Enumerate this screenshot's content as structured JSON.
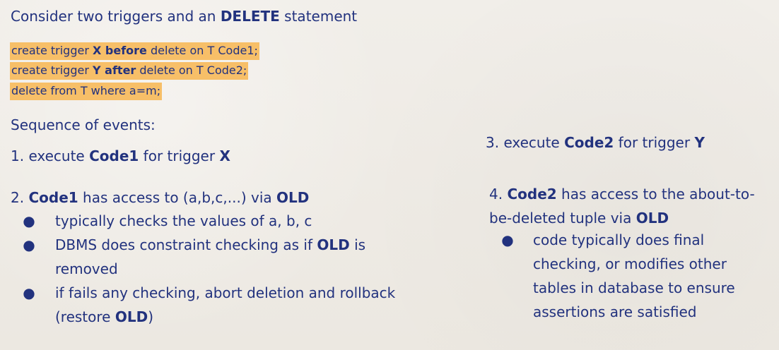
{
  "title": {
    "part1": "Consider two triggers and an ",
    "bold": "DELETE",
    "part2": " statement"
  },
  "code": {
    "line1": {
      "prefix": "create trigger ",
      "bold": "X before",
      "suffix": " delete on T Code1;"
    },
    "line2": {
      "prefix": "create trigger ",
      "bold": "Y after",
      "suffix": " delete on T Code2;"
    },
    "line3": "delete from T where a=m;"
  },
  "sequence_heading": "Sequence of events:",
  "steps": {
    "step1": {
      "prefix": "1. execute ",
      "bold1": "Code1",
      "middle": " for trigger ",
      "bold2": "X"
    },
    "step2": {
      "prefix": "2. ",
      "bold1": "Code1",
      "middle": " has access to (a,b,c,...) via ",
      "bold2": "OLD",
      "bullets": {
        "b1": "typically checks the values of a, b, c",
        "b2": {
          "prefix": "DBMS does constraint checking as if ",
          "bold": "OLD",
          "suffix": " is removed"
        },
        "b3": {
          "prefix": "if fails any checking, abort deletion and rollback (restore ",
          "bold": "OLD",
          "suffix": ")"
        }
      }
    },
    "step3": {
      "prefix": "3. execute ",
      "bold1": "Code2",
      "middle": " for trigger ",
      "bold2": "Y"
    },
    "step4": {
      "prefix": "4. ",
      "bold1": "Code2",
      "middle": " has access to the about-to-be-deleted tuple via ",
      "bold2": "OLD",
      "bullet": "code typically does final checking, or modifies other tables in database to ensure assertions are satisfied"
    }
  },
  "bullet_symbol": "●"
}
